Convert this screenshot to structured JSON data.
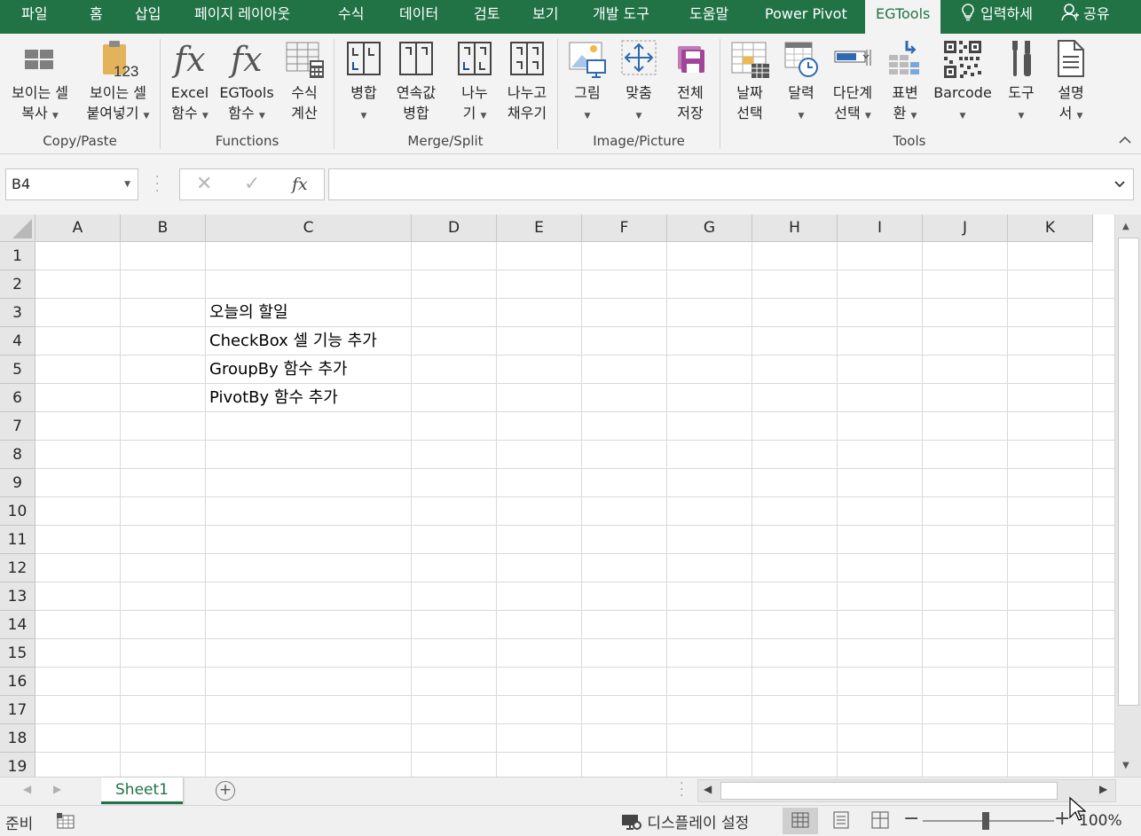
{
  "tabs": [
    {
      "label": "파일"
    },
    {
      "label": "홈"
    },
    {
      "label": "삽입"
    },
    {
      "label": "페이지 레이아웃"
    },
    {
      "label": "수식"
    },
    {
      "label": "데이터"
    },
    {
      "label": "검토"
    },
    {
      "label": "보기"
    },
    {
      "label": "개발 도구"
    },
    {
      "label": "도움말"
    },
    {
      "label": "Power Pivot"
    },
    {
      "label": "EGTools"
    }
  ],
  "tell_me": "입력하세",
  "share": "공유",
  "ribbon": {
    "groups": [
      {
        "label": "Copy/Paste"
      },
      {
        "label": "Functions"
      },
      {
        "label": "Merge/Split"
      },
      {
        "label": "Image/Picture"
      },
      {
        "label": "Tools"
      }
    ],
    "buttons": {
      "copy_visible": {
        "line1": "보이는 셀",
        "line2": "복사"
      },
      "paste_visible": {
        "line1": "보이는 셀",
        "line2": "붙여넣기",
        "icon_text": "123"
      },
      "excel_func": {
        "line1": "Excel",
        "line2": "함수"
      },
      "egtools_func": {
        "line1": "EGTools",
        "line2": "함수"
      },
      "formula_calc": {
        "line1": "수식",
        "line2": "계산"
      },
      "merge": {
        "line1": "병합"
      },
      "merge_continuous": {
        "line1": "연속값",
        "line2": "병합"
      },
      "split": {
        "line1": "나누",
        "line2": "기"
      },
      "split_fill": {
        "line1": "나누고",
        "line2": "채우기"
      },
      "picture": {
        "line1": "그림"
      },
      "fit": {
        "line1": "맞춤"
      },
      "save_all": {
        "line1": "전체",
        "line2": "저장"
      },
      "date_pick": {
        "line1": "날짜",
        "line2": "선택"
      },
      "calendar": {
        "line1": "달력"
      },
      "multilevel": {
        "line1": "다단계",
        "line2": "선택"
      },
      "table_convert": {
        "line1": "표변",
        "line2": "환"
      },
      "barcode": {
        "line1": "Barcode"
      },
      "tools": {
        "line1": "도구"
      },
      "help": {
        "line1": "설명",
        "line2": "서"
      }
    }
  },
  "formula_bar": {
    "name_box": "B4",
    "formula": ""
  },
  "columns": [
    "A",
    "B",
    "C",
    "D",
    "E",
    "F",
    "G",
    "H",
    "I",
    "J",
    "K"
  ],
  "rows": [
    "1",
    "2",
    "3",
    "4",
    "5",
    "6",
    "7",
    "8",
    "9",
    "10",
    "11",
    "12",
    "13",
    "14",
    "15",
    "16",
    "17",
    "18",
    "19"
  ],
  "cells": {
    "C3": "오늘의 할일",
    "C4": "CheckBox 셀 기능 추가",
    "C5": "GroupBy 함수 추가",
    "C6": "PivotBy 함수 추가"
  },
  "sheets": [
    "Sheet1"
  ],
  "status": {
    "ready": "준비",
    "display_settings": "디스플레이 설정",
    "zoom": "100%",
    "zoom_fraction": 0.5
  },
  "colors": {
    "accent": "#217346",
    "ribbon_bg": "#f3f3f3",
    "header_bg": "#e6e6e6",
    "gridline": "#d9d9d9"
  }
}
